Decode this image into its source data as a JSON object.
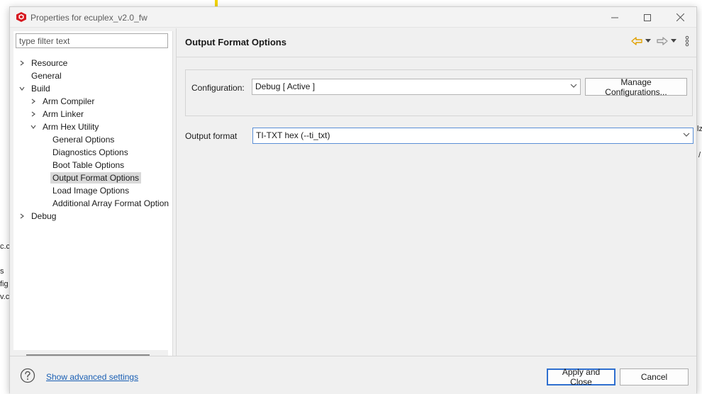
{
  "background": {
    "fragments": [
      "c.c",
      "s",
      "fig",
      "v.c",
      "lz",
      "/"
    ]
  },
  "window": {
    "title": "Properties for ecuplex_v2.0_fw"
  },
  "filter": {
    "placeholder": "type filter text"
  },
  "tree": {
    "items": [
      {
        "label": "Resource",
        "twisty": "collapsed"
      },
      {
        "label": "General",
        "twisty": "none"
      },
      {
        "label": "Build",
        "twisty": "expanded"
      },
      {
        "label": "Arm Compiler",
        "twisty": "collapsed"
      },
      {
        "label": "Arm Linker",
        "twisty": "collapsed"
      },
      {
        "label": "Arm Hex Utility",
        "twisty": "expanded"
      },
      {
        "label": "General Options",
        "twisty": "none"
      },
      {
        "label": "Diagnostics Options",
        "twisty": "none"
      },
      {
        "label": "Boot Table Options",
        "twisty": "none"
      },
      {
        "label": "Output Format Options",
        "twisty": "none",
        "selected": true
      },
      {
        "label": "Load Image Options",
        "twisty": "none"
      },
      {
        "label": "Additional Array Format Option",
        "twisty": "none"
      },
      {
        "label": "Debug",
        "twisty": "collapsed"
      }
    ]
  },
  "page": {
    "title": "Output Format Options",
    "configuration_label": "Configuration:",
    "configuration_value": "Debug  [ Active ]",
    "manage_button": "Manage Configurations...",
    "output_format_label": "Output format",
    "output_format_value": "TI-TXT hex (--ti_txt)"
  },
  "footer": {
    "advanced_link": "Show advanced settings",
    "apply_button": "Apply and Close",
    "cancel_button": "Cancel"
  },
  "colors": {
    "back_arrow": "#e0a000",
    "link": "#1a5fb4",
    "selected": "#d9d9d9",
    "focus": "#2f6fcf"
  }
}
